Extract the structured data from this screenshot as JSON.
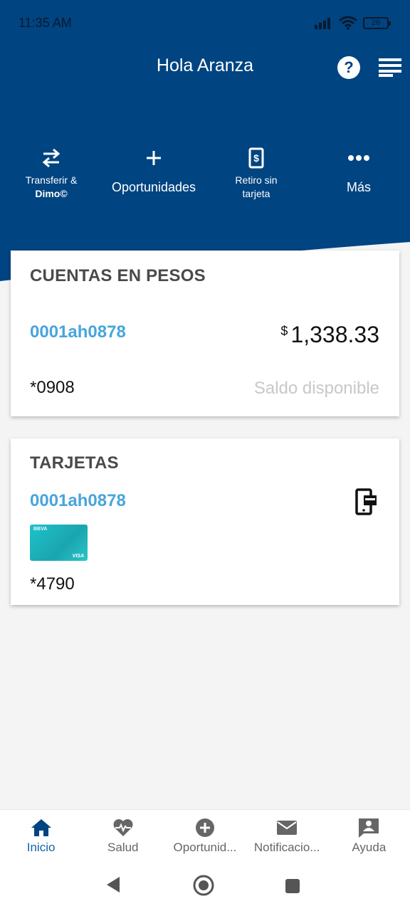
{
  "status_bar": {
    "time": "11:35 AM",
    "battery": "26"
  },
  "header": {
    "greeting": "Hola Aranza",
    "help_icon": "question-icon",
    "menu_icon": "menu-icon",
    "background": "#004481"
  },
  "quick_actions": [
    {
      "line1": "Transferir &",
      "line2": "Dimo©",
      "icon": "transfer-icon"
    },
    {
      "label": "Oportunidades",
      "icon": "plus-icon"
    },
    {
      "line1": "Retiro sin",
      "line2": "tarjeta",
      "icon": "cardless-withdrawal-icon"
    },
    {
      "label": "Más",
      "icon": "more-icon"
    }
  ],
  "accounts_card": {
    "title": "CUENTAS EN PESOS",
    "account_name": "0001ah0878",
    "currency": "$",
    "amount": "1,338.33",
    "account_mask": "*0908",
    "balance_label": "Saldo disponible"
  },
  "cards_card": {
    "title": "TARJETAS",
    "account_name": "0001ah0878",
    "card_mask": "*4790",
    "card_brand": "BBVA",
    "card_network": "VISA",
    "icon": "mobile-card-icon"
  },
  "bottom_nav": [
    {
      "label": "Inicio",
      "icon": "home-icon",
      "active": true
    },
    {
      "label": "Salud",
      "icon": "heart-pulse-icon"
    },
    {
      "label": "Oportunid...",
      "icon": "plus-circle-icon"
    },
    {
      "label": "Notificacio...",
      "icon": "mail-icon"
    },
    {
      "label": "Ayuda",
      "icon": "chat-person-icon"
    }
  ],
  "colors": {
    "brand": "#004481",
    "link": "#48a5dc",
    "nav_active": "#1464a5"
  }
}
